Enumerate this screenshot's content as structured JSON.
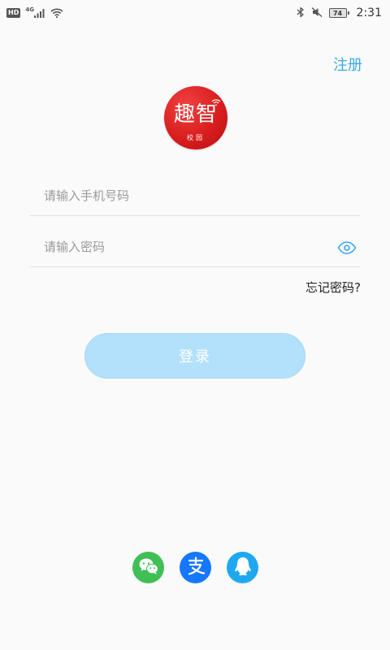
{
  "status_bar": {
    "hd_label": "HD",
    "network_label": "4G",
    "battery_level": "74",
    "time": "2:31"
  },
  "header": {
    "register_label": "注册"
  },
  "logo": {
    "main_text": "趣智",
    "sub_text": "校园",
    "color": "#d91e1e"
  },
  "form": {
    "phone_placeholder": "请输入手机号码",
    "phone_value": "",
    "password_placeholder": "请输入密码",
    "password_value": "",
    "forgot_label": "忘记密码?",
    "login_label": "登录"
  },
  "social": [
    {
      "name": "wechat",
      "icon": "wechat-icon",
      "color": "#3fbf55"
    },
    {
      "name": "alipay",
      "icon": "alipay-icon",
      "color": "#1677ff"
    },
    {
      "name": "qq",
      "icon": "qq-icon",
      "color": "#1fa8f0"
    }
  ],
  "colors": {
    "accent": "#3aa8e8",
    "login_button_bg": "#b3e0fb",
    "background": "#fafafa"
  }
}
